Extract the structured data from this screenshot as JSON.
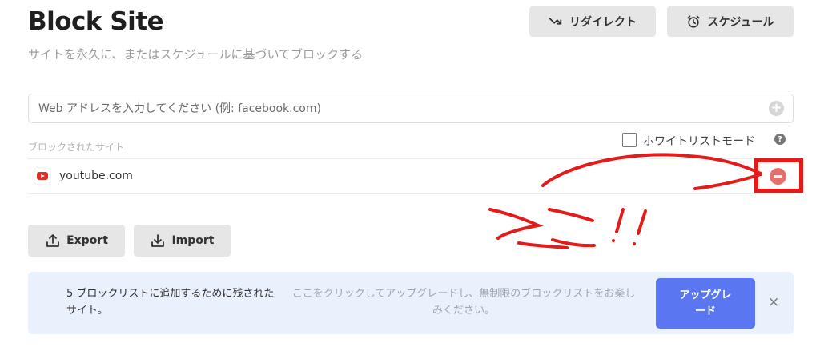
{
  "header": {
    "title": "Block Site",
    "subtitle": "サイトを永久に、またはスケジュールに基づいてブロックする",
    "redirect_label": "リダイレクト",
    "schedule_label": "スケジュール"
  },
  "input": {
    "placeholder": "Web アドレスを入力してください (例: facebook.com)"
  },
  "blocked_list": {
    "label": "ブロックされたサイト",
    "whitelist_label": "ホワイトリストモード",
    "whitelist_checked": false,
    "sites": [
      {
        "name": "youtube.com",
        "icon": "youtube-icon"
      }
    ]
  },
  "annotation": {
    "text": "ここ!!",
    "color": "#e31b1b"
  },
  "actions": {
    "export_label": "Export",
    "import_label": "Import"
  },
  "banner": {
    "left_text": "5 ブロックリストに追加するために残されたサイト。",
    "mid_text": "ここをクリックしてアップグレードし、無制限のブロックリストをお楽しみください。",
    "upgrade_label": "アップグレード",
    "close_label": "×"
  },
  "colors": {
    "accent": "#5a76f0",
    "remove": "#e8706c",
    "annotation": "#e31b1b",
    "banner_bg": "#e8f1fc"
  }
}
